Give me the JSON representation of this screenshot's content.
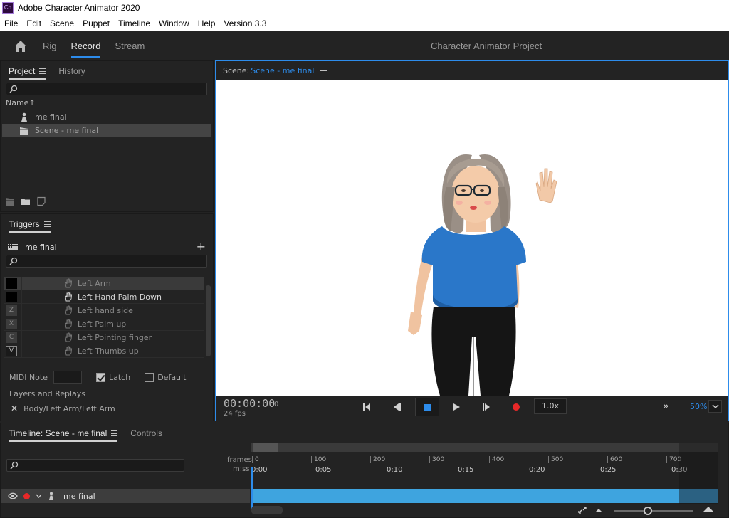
{
  "titlebar": {
    "icon_text": "Ch",
    "title": "Adobe Character Animator 2020"
  },
  "menu": [
    "File",
    "Edit",
    "Scene",
    "Puppet",
    "Timeline",
    "Window",
    "Help",
    "Version 3.3"
  ],
  "workspace": {
    "tabs": [
      {
        "label": "Rig",
        "active": false
      },
      {
        "label": "Record",
        "active": true
      },
      {
        "label": "Stream",
        "active": false
      }
    ],
    "project_title": "Character Animator Project"
  },
  "project_panel": {
    "tabs": [
      "Project",
      "History"
    ],
    "name_col": "Name",
    "items": [
      {
        "label": "me final",
        "icon": "puppet-icon",
        "selected": false
      },
      {
        "label": "Scene - me final",
        "icon": "clapper-icon",
        "selected": true
      }
    ]
  },
  "triggers_panel": {
    "title": "Triggers",
    "puppet": "me final",
    "triggers": [
      {
        "key": "",
        "label": "Left Arm",
        "key_style": "black",
        "selected": true
      },
      {
        "key": "",
        "label": "Left Hand Palm Down",
        "key_style": "black",
        "bright": true
      },
      {
        "key": "Z",
        "label": "Left hand side",
        "key_style": "gray"
      },
      {
        "key": "X",
        "label": "Left Palm up",
        "key_style": "gray"
      },
      {
        "key": "C",
        "label": "Left Pointing finger",
        "key_style": "gray"
      },
      {
        "key": "V",
        "label": "Left Thumbs up",
        "key_style": "boxed"
      }
    ],
    "midi_label": "MIDI Note",
    "latch_label": "Latch",
    "latch_checked": true,
    "default_label": "Default",
    "default_checked": false,
    "layers_label": "Layers and Replays",
    "layer_path": "Body/Left Arm/Left Arm"
  },
  "scene_panel": {
    "label": "Scene:",
    "scene_name": "Scene - me final",
    "timecode": "00:00:00",
    "frame": "0",
    "fps": "24 fps",
    "speed": "1.0x",
    "zoom": "50%"
  },
  "timeline_panel": {
    "tabs": [
      "Timeline: Scene - me final",
      "Controls"
    ],
    "frames_label": "frames",
    "mss_label": "m:ss",
    "frame_ticks": [
      "0",
      "100",
      "200",
      "300",
      "400",
      "500",
      "600",
      "700"
    ],
    "time_ticks": [
      "0:00",
      "0:05",
      "0:10",
      "0:15",
      "0:20",
      "0:25",
      "0:30"
    ],
    "track_name": "me final"
  },
  "colors": {
    "accent": "#2d8ceb",
    "track": "#3ea4df",
    "record": "#e82828"
  }
}
